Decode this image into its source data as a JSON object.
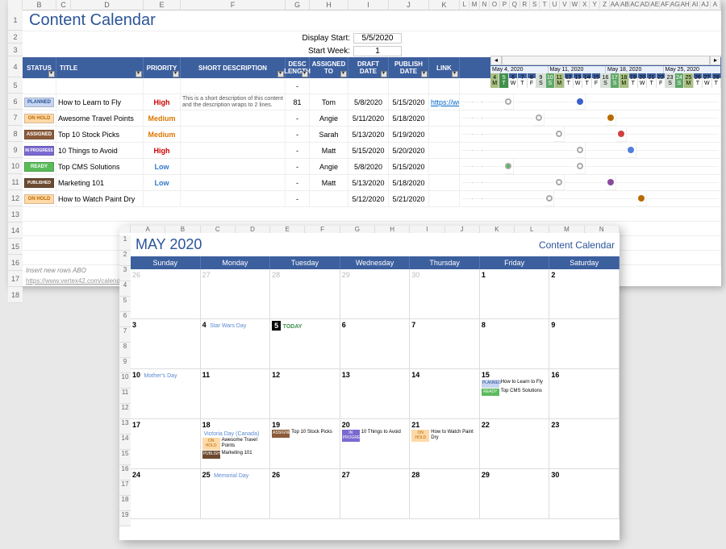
{
  "sheet1": {
    "title": "Content Calendar",
    "col_letters": [
      "B",
      "C",
      "D",
      "E",
      "F",
      "G",
      "H",
      "I",
      "J",
      "K",
      "L",
      "M",
      "N",
      "O",
      "P",
      "Q",
      "R",
      "S",
      "T",
      "U",
      "V",
      "W",
      "X",
      "Y",
      "Z",
      "AA",
      "AB",
      "AC",
      "AD",
      "AE",
      "AF",
      "AG",
      "AH",
      "AI",
      "AJ",
      "A"
    ],
    "row_nums": [
      "1",
      "2",
      "3",
      "4",
      "5",
      "6",
      "7",
      "8",
      "9",
      "10",
      "11",
      "12",
      "13",
      "14",
      "15",
      "16",
      "17",
      "18"
    ],
    "config": [
      {
        "label": "Display Start:",
        "value": "5/5/2020"
      },
      {
        "label": "Start Week:",
        "value": "1"
      }
    ],
    "headers": [
      "STATUS",
      "TITLE",
      "PRIORITY",
      "SHORT DESCRIPTION",
      "DESC LENGTH",
      "ASSIGNED TO",
      "DRAFT DATE",
      "PUBLISH DATE",
      "LINK"
    ],
    "rows": [
      {
        "status": "PLANNED",
        "status_class": "st-planned",
        "title": "How to Learn to Fly",
        "priority": "High",
        "pri_class": "pri-high",
        "desc": "This is a short description of this content and the description wraps to 2 lines.",
        "desclen": "81",
        "assigned": "Tom",
        "draft": "5/8/2020",
        "publish": "5/15/2020",
        "link": "https://ww"
      },
      {
        "status": "ON HOLD",
        "status_class": "st-onhold",
        "title": "Awesome Travel Points",
        "priority": "Medium",
        "pri_class": "pri-medium",
        "desc": "",
        "desclen": "-",
        "assigned": "Angie",
        "draft": "5/11/2020",
        "publish": "5/18/2020",
        "link": ""
      },
      {
        "status": "ASSIGNED",
        "status_class": "st-assigned",
        "title": "Top 10 Stock Picks",
        "priority": "Medium",
        "pri_class": "pri-medium",
        "desc": "",
        "desclen": "-",
        "assigned": "Sarah",
        "draft": "5/13/2020",
        "publish": "5/19/2020",
        "link": ""
      },
      {
        "status": "IN PROGRESS",
        "status_class": "st-inprog",
        "title": "10 Things to Avoid",
        "priority": "High",
        "pri_class": "pri-high",
        "desc": "",
        "desclen": "-",
        "assigned": "Matt",
        "draft": "5/15/2020",
        "publish": "5/20/2020",
        "link": ""
      },
      {
        "status": "READY",
        "status_class": "st-ready",
        "title": "Top CMS Solutions",
        "priority": "Low",
        "pri_class": "pri-low",
        "desc": "",
        "desclen": "-",
        "assigned": "Angie",
        "draft": "5/8/2020",
        "publish": "5/15/2020",
        "link": ""
      },
      {
        "status": "PUBLISHED",
        "status_class": "st-published",
        "title": "Marketing 101",
        "priority": "Low",
        "pri_class": "pri-low",
        "desc": "",
        "desclen": "-",
        "assigned": "Matt",
        "draft": "5/13/2020",
        "publish": "5/18/2020",
        "link": ""
      },
      {
        "status": "ON HOLD",
        "status_class": "st-onhold",
        "title": "How to Watch Paint Dry",
        "priority": "",
        "pri_class": "",
        "desc": "",
        "desclen": "-",
        "assigned": "",
        "draft": "5/12/2020",
        "publish": "5/21/2020",
        "link": ""
      }
    ],
    "gantt": {
      "weeks": [
        "May 4, 2020",
        "May 11, 2020",
        "May 18, 2020",
        "May 25, 2020"
      ],
      "days": [
        {
          "l": "M",
          "c": "gd-mon"
        },
        {
          "l": "T",
          "c": "gd-today"
        },
        {
          "l": "W",
          "c": ""
        },
        {
          "l": "T",
          "c": ""
        },
        {
          "l": "F",
          "c": ""
        },
        {
          "l": "S",
          "c": "gd-weekend"
        },
        {
          "l": "S",
          "c": "gd-sun"
        },
        {
          "l": "M",
          "c": "gd-mon"
        },
        {
          "l": "T",
          "c": ""
        },
        {
          "l": "W",
          "c": ""
        },
        {
          "l": "T",
          "c": ""
        },
        {
          "l": "F",
          "c": ""
        },
        {
          "l": "S",
          "c": "gd-weekend"
        },
        {
          "l": "S",
          "c": "gd-sun"
        },
        {
          "l": "M",
          "c": "gd-mon"
        },
        {
          "l": "T",
          "c": ""
        },
        {
          "l": "W",
          "c": ""
        },
        {
          "l": "T",
          "c": ""
        },
        {
          "l": "F",
          "c": ""
        },
        {
          "l": "S",
          "c": "gd-weekend"
        },
        {
          "l": "S",
          "c": "gd-sun"
        },
        {
          "l": "M",
          "c": "gd-mon"
        },
        {
          "l": "T",
          "c": ""
        },
        {
          "l": "W",
          "c": ""
        },
        {
          "l": "T",
          "c": ""
        }
      ],
      "markers": [
        [
          {
            "col": 4,
            "c": "mk-dot-gray"
          },
          {
            "col": 11,
            "c": "mk-blue"
          }
        ],
        [
          {
            "col": 7,
            "c": "mk-dot-gray"
          },
          {
            "col": 14,
            "c": "mk-brown"
          }
        ],
        [
          {
            "col": 9,
            "c": "mk-dot-gray"
          },
          {
            "col": 15,
            "c": "mk-red"
          }
        ],
        [
          {
            "col": 11,
            "c": "mk-dot-gray"
          },
          {
            "col": 16,
            "c": "mk-blue2"
          }
        ],
        [
          {
            "col": 4,
            "c": "mk-green"
          },
          {
            "col": 11,
            "c": "mk-dot-gray"
          }
        ],
        [
          {
            "col": 9,
            "c": "mk-dot-gray"
          },
          {
            "col": 14,
            "c": "mk-purple"
          }
        ],
        [
          {
            "col": 8,
            "c": "mk-dot-gray"
          },
          {
            "col": 17,
            "c": "mk-brown"
          }
        ]
      ]
    },
    "footer_note": "Insert new rows ABO",
    "footer_link": "https://www.vertex42.com/calenda"
  },
  "sheet2": {
    "col_letters": [
      "A",
      "B",
      "C",
      "D",
      "E",
      "F",
      "G",
      "H",
      "I",
      "J",
      "K",
      "L",
      "M",
      "N"
    ],
    "row_nums": [
      "1",
      "2",
      "3",
      "4",
      "5",
      "6",
      "7",
      "8",
      "9",
      "10",
      "11",
      "12",
      "13",
      "14",
      "15",
      "16",
      "17",
      "18",
      "19"
    ],
    "month_title": "MAY 2020",
    "subtitle": "Content Calendar",
    "dow": [
      "Sunday",
      "Monday",
      "Tuesday",
      "Wednesday",
      "Thursday",
      "Friday",
      "Saturday"
    ],
    "cells": [
      {
        "n": "26",
        "gray": true
      },
      {
        "n": "27",
        "gray": true
      },
      {
        "n": "28",
        "gray": true
      },
      {
        "n": "29",
        "gray": true
      },
      {
        "n": "30",
        "gray": true
      },
      {
        "n": "1"
      },
      {
        "n": "2"
      },
      {
        "n": "3"
      },
      {
        "n": "4",
        "holiday": "Star Wars Day"
      },
      {
        "n": "5",
        "today": true,
        "today_label": "TODAY"
      },
      {
        "n": "6"
      },
      {
        "n": "7"
      },
      {
        "n": "8"
      },
      {
        "n": "9"
      },
      {
        "n": "10",
        "holiday": "Mother's Day"
      },
      {
        "n": "11"
      },
      {
        "n": "12"
      },
      {
        "n": "13"
      },
      {
        "n": "14"
      },
      {
        "n": "15",
        "items": [
          {
            "badge": "PLANNED",
            "bc": "st-planned",
            "text": "How to Learn to Fly"
          },
          {
            "badge": "READY",
            "bc": "st-ready",
            "text": "Top CMS Solutions"
          }
        ]
      },
      {
        "n": "16"
      },
      {
        "n": "17"
      },
      {
        "n": "18",
        "holiday": "Victoria Day (Canada)",
        "items": [
          {
            "badge": "ON HOLD",
            "bc": "st-onhold",
            "text": "Awesome Travel Points"
          },
          {
            "badge": "PUBLISHED",
            "bc": "st-published",
            "text": "Marketing 101"
          }
        ]
      },
      {
        "n": "19",
        "items": [
          {
            "badge": "ASSIGNED",
            "bc": "st-assigned",
            "text": "Top 10 Stock Picks"
          }
        ]
      },
      {
        "n": "20",
        "items": [
          {
            "badge": "IN PROGRESS",
            "bc": "st-inprog",
            "text": "10 Things to Avoid"
          }
        ]
      },
      {
        "n": "21",
        "items": [
          {
            "badge": "ON HOLD",
            "bc": "st-onhold",
            "text": "How to Watch Paint Dry"
          }
        ]
      },
      {
        "n": "22"
      },
      {
        "n": "23"
      },
      {
        "n": "24"
      },
      {
        "n": "25",
        "holiday": "Memorial Day"
      },
      {
        "n": "26"
      },
      {
        "n": "27"
      },
      {
        "n": "28"
      },
      {
        "n": "29"
      },
      {
        "n": "30"
      }
    ]
  }
}
